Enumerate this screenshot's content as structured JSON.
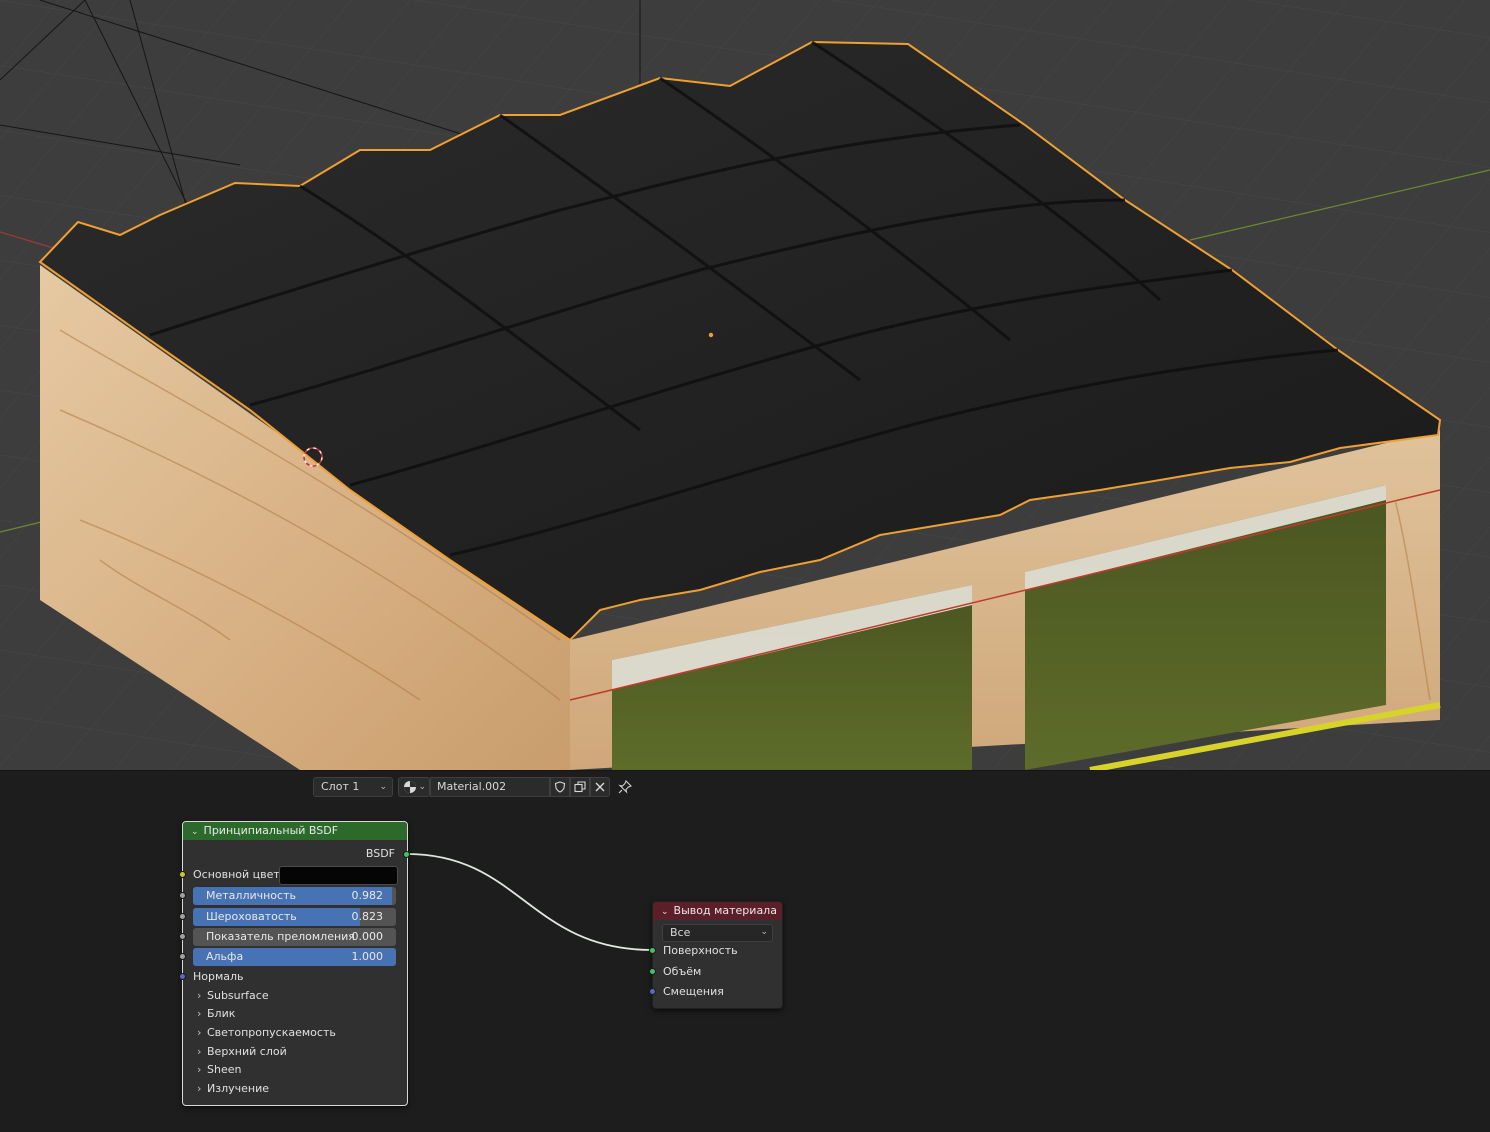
{
  "header": {
    "slot_label": "Слот 1",
    "material_name": "Material.002",
    "icons": [
      "material-sphere-icon",
      "chevron-down-icon",
      "fake-user-shield-icon",
      "duplicate-icon",
      "close-icon",
      "pin-icon"
    ]
  },
  "bsdf_node": {
    "title": "Принципиальный BSDF",
    "output_label": "BSDF",
    "base_color_label": "Основной цвет",
    "base_color": "#050505",
    "metallic": {
      "label": "Металличность",
      "value": "0.982",
      "fraction": 0.982
    },
    "roughness": {
      "label": "Шероховатость",
      "value": "0.823",
      "fraction": 0.823
    },
    "ior": {
      "label": "Показатель преломления",
      "value": "0.000",
      "fraction": 0.0
    },
    "alpha": {
      "label": "Альфа",
      "value": "1.000",
      "fraction": 1.0
    },
    "normal_label": "Нормаль",
    "panels": [
      "Subsurface",
      "Блик",
      "Светопропускаемость",
      "Верхний слой",
      "Sheen",
      "Излучение"
    ],
    "header_color": "#2b6a2b"
  },
  "output_node": {
    "title": "Вывод материала",
    "target": "Все",
    "inputs": [
      "Поверхность",
      "Объём",
      "Смещения"
    ],
    "header_color": "#5c1f2a"
  },
  "colors": {
    "selection_outline": "#f0a030",
    "socket_shader": "#3fc46a",
    "socket_color": "#c7c729",
    "socket_float": "#a1a1a1",
    "socket_vector": "#6363c7",
    "slider_fill": "#4772b3"
  }
}
